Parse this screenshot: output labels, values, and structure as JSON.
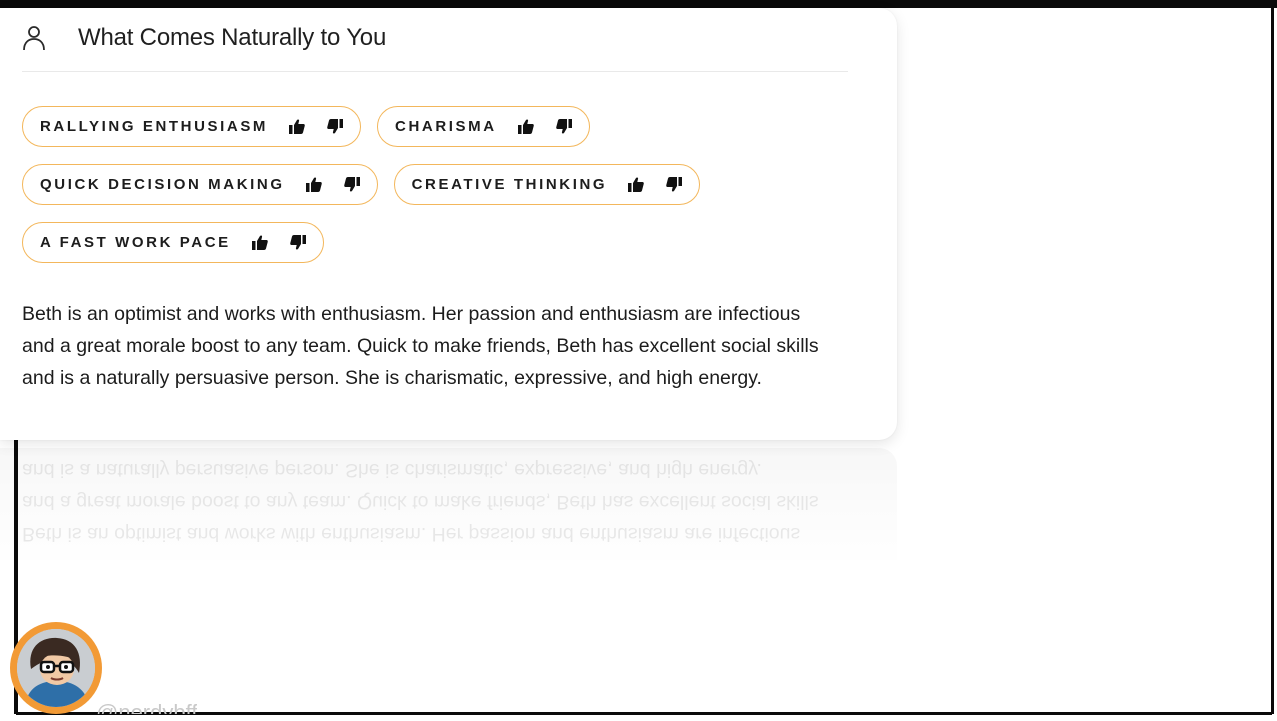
{
  "card": {
    "title": "What Comes Naturally to You",
    "icon": "user-icon"
  },
  "tags": [
    {
      "label": "RALLYING ENTHUSIASM"
    },
    {
      "label": "CHARISMA"
    },
    {
      "label": "QUICK DECISION MAKING"
    },
    {
      "label": "CREATIVE THINKING"
    },
    {
      "label": "A FAST WORK PACE"
    }
  ],
  "description": "Beth is an optimist and works with enthusiasm. Her passion and enthusiasm are infectious and a great morale boost to any team. Quick to make friends, Beth has excellent social skills and is a naturally persuasive person. She is charismatic, expressive, and high energy.",
  "watermark": {
    "handle": "@nerdybff"
  },
  "colors": {
    "tag_border": "#f3b75c",
    "avatar_ring": "#f29a35"
  }
}
